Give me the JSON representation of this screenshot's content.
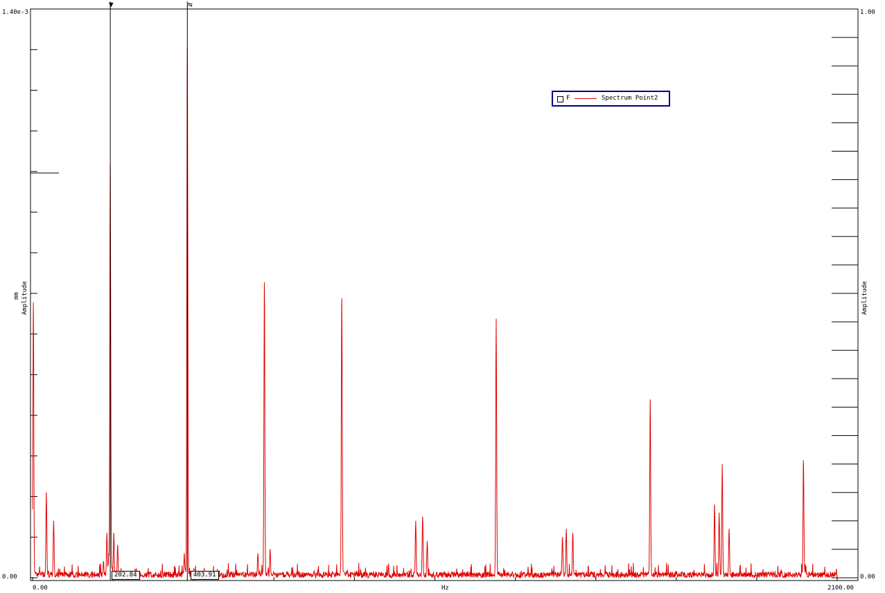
{
  "chart_data": {
    "type": "line",
    "xlabel": "Hz",
    "ylabel_left": [
      "mm",
      "Amplitude"
    ],
    "ylabel_right": "Amplitude",
    "xlim": [
      0,
      2100
    ],
    "ylim_left": [
      0,
      0.0014
    ],
    "ylim_right": [
      0,
      1
    ],
    "x_tick_labels": [
      "0.00",
      "2100.00"
    ],
    "y_left_tick_labels": [
      "1.40e-3",
      "0.00"
    ],
    "y_right_tick_labels": [
      "1.00",
      "0.00"
    ],
    "grid": false,
    "legend": {
      "placement": "upper-right",
      "flag": "F",
      "entries": [
        "Spectrum Point2"
      ]
    },
    "series": [
      {
        "name": "Spectrum Point2",
        "color": "#e00000",
        "peaks": [
          {
            "x": 2,
            "y": 0.00068
          },
          {
            "x": 36,
            "y": 0.00021
          },
          {
            "x": 55,
            "y": 0.00014
          },
          {
            "x": 185,
            "y": 4e-05
          },
          {
            "x": 194,
            "y": 0.00011
          },
          {
            "x": 199,
            "y": 6e-05
          },
          {
            "x": 202.84,
            "y": 0.00102
          },
          {
            "x": 212,
            "y": 0.00011
          },
          {
            "x": 222,
            "y": 8e-05
          },
          {
            "x": 396,
            "y": 6e-05
          },
          {
            "x": 403.91,
            "y": 0.00131
          },
          {
            "x": 588,
            "y": 6e-05
          },
          {
            "x": 605,
            "y": 0.00073
          },
          {
            "x": 620,
            "y": 7e-05
          },
          {
            "x": 807,
            "y": 0.00069
          },
          {
            "x": 1000,
            "y": 0.00014
          },
          {
            "x": 1018,
            "y": 0.00015
          },
          {
            "x": 1030,
            "y": 9e-05
          },
          {
            "x": 1210,
            "y": 0.00064
          },
          {
            "x": 1383,
            "y": 0.0001
          },
          {
            "x": 1393,
            "y": 0.00012
          },
          {
            "x": 1410,
            "y": 0.00011
          },
          {
            "x": 1612,
            "y": 0.00044
          },
          {
            "x": 1780,
            "y": 0.00018
          },
          {
            "x": 1792,
            "y": 0.00016
          },
          {
            "x": 1800,
            "y": 0.00028
          },
          {
            "x": 1818,
            "y": 0.00012
          },
          {
            "x": 2012,
            "y": 0.00029
          }
        ],
        "noise_floor": 1.5e-05
      }
    ],
    "cursors": [
      {
        "symbol": "▼",
        "x": 202.84,
        "label": "202.84"
      },
      {
        "symbol": "⇆",
        "x": 403.91,
        "label": "403.91"
      }
    ]
  }
}
